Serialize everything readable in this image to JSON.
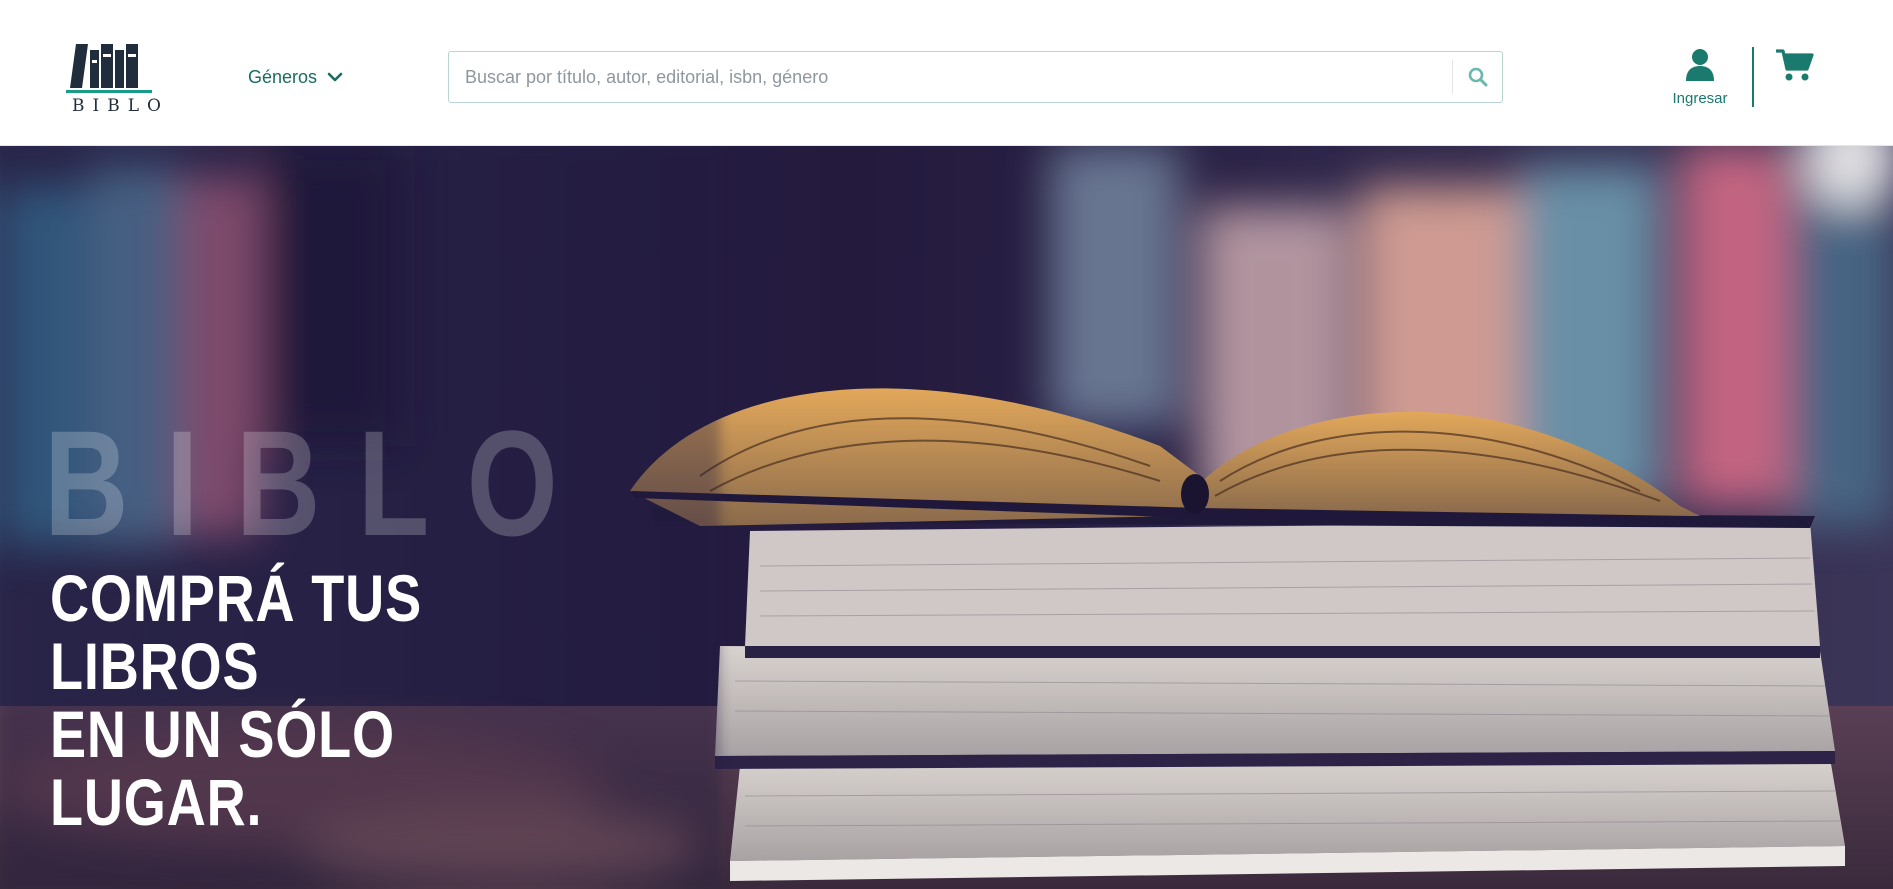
{
  "header": {
    "logo": {
      "text": "BIBLO",
      "icon": "books-logo-icon"
    },
    "genres_label": "Géneros",
    "search": {
      "placeholder": "Buscar por título, autor, editorial, isbn, género",
      "value": ""
    },
    "login_label": "Ingresar",
    "cart_icon": "cart-icon"
  },
  "hero": {
    "watermark": "BIBLO",
    "headline_line1": "COMPRÁ TUS LIBROS",
    "headline_line2": "EN UN SÓLO LUGAR."
  },
  "colors": {
    "accent": "#1a7a6e",
    "accent_dark": "#1a6b61",
    "logo_dark": "#1f2d3d",
    "search_border": "#b7d6d2",
    "hero_overlay": "#2a2046"
  }
}
